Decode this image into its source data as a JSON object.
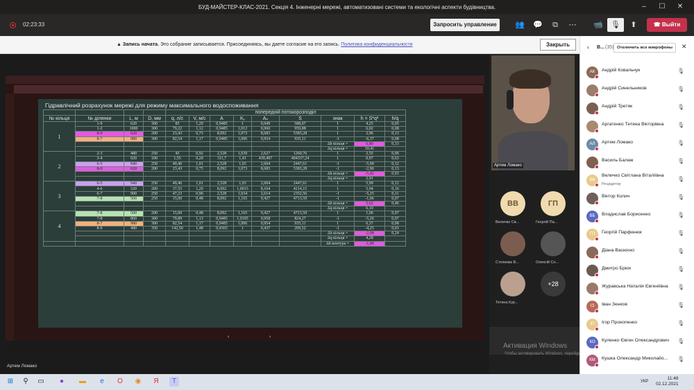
{
  "window": {
    "title": "БУД-МАЙСТЕР-КЛАС-2021. Секція 4. Інженерні мережі, автоматизовані системи та екологічні аспекти будівництва."
  },
  "toolbar": {
    "timer": "02:23:33",
    "request_control": "Запросить управление",
    "leave": "Выйти"
  },
  "notification": {
    "bold": "Запись начата.",
    "text": "Это собрание записывается. Присоединяясь, вы даете согласие на его запись.",
    "link": "Политика конфиденциальности",
    "close": "Закрыть"
  },
  "slide": {
    "title": "Гідравлічний розрахунок мережі для режиму максимального водоспоживання",
    "group_header": "попередній потокорозподіл",
    "headers": [
      "№ кільця",
      "№ ділянки",
      "L, м",
      "D, мм",
      "q, л/с",
      "V, м/с",
      "A",
      "K₁",
      "Aₙ",
      "S",
      "знак",
      "h = S*q²",
      "h/q"
    ],
    "delta_h": "Δh кільця =",
    "delta_q": "Δq кільця =",
    "delta_contour": "Δh контура =",
    "rings": [
      {
        "n": "1",
        "rows": [
          [
            "1-9",
            "620",
            "300",
            "85",
            "1,20",
            "0,9485",
            "1",
            "0,949",
            "588,07",
            "1",
            "4,25",
            "0,05",
            ""
          ],
          [
            "1-2",
            "1000",
            "300",
            "79,22",
            "1,12",
            "0,9485",
            "1,012",
            "0,960",
            "959,88",
            "1",
            "6,02",
            "0,08",
            ""
          ],
          [
            "8-9",
            "620",
            "200",
            "23,43",
            "0,75",
            "8,092",
            "1,073",
            "8,683",
            "5383,28",
            "1",
            "2,96",
            "0,13",
            "pk"
          ],
          [
            "8-7",
            "980",
            "300",
            "82,54",
            "1,17",
            "0,9485",
            "1,006",
            "0,954",
            "935,11",
            "-1",
            "-6,37",
            "0,08",
            "or"
          ]
        ],
        "dh": "6,80",
        "sum": "0,33",
        "dq": "10,41"
      },
      {
        "n": "2",
        "rows": [
          [
            "2-3",
            "480",
            "250",
            "45",
            "0,92",
            "2,528",
            "1,039",
            "2,627",
            "1260,76",
            "1",
            "2,55",
            "0,06",
            ""
          ],
          [
            "3-4",
            "920",
            "100",
            "1,55",
            "0,20",
            "311,7",
            "1,41",
            "439,497",
            "404337,24",
            "1",
            "0,97",
            "0,63",
            ""
          ],
          [
            "6-5",
            "940",
            "250",
            "49,46",
            "1,01",
            "2,528",
            "1,03",
            "2,604",
            "2447,61",
            "-1",
            "-5,99",
            "0,12",
            "lil"
          ],
          [
            "8-9",
            "620",
            "200",
            "23,43",
            "0,75",
            "8,092",
            "1,073",
            "8,683",
            "5383,28",
            "-1",
            "-2,96",
            "0,13",
            "pk"
          ]
        ],
        "dh": "-5,42",
        "sum": "0,93",
        "dq": "2,91"
      },
      {
        "n": "3",
        "rows": [
          [
            "6-5",
            "940",
            "250",
            "49,46",
            "1,01",
            "2,528",
            "1,03",
            "2,604",
            "2447,61",
            "1",
            "5,99",
            "0,12",
            "lil"
          ],
          [
            "4-6",
            "520",
            "200",
            "37,55",
            "1,20",
            "8,092",
            "1,0015",
            "8,104",
            "4214,15",
            "1",
            "5,94",
            "0,16",
            ""
          ],
          [
            "6-7",
            "900",
            "250",
            "47,23",
            "0,96",
            "2,528",
            "1,034",
            "2,614",
            "2352,56",
            "-1",
            "-5,25",
            "0,11",
            ""
          ],
          [
            "7-8",
            "500",
            "250",
            "15,00",
            "0,48",
            "8,092",
            "1,165",
            "9,427",
            "4713,59",
            "-1",
            "-1,06",
            "0,07",
            "gr"
          ]
        ],
        "dh": "5,62",
        "sum": "0,46",
        "dq": "6,10"
      },
      {
        "n": "4",
        "rows": [
          [
            "7-8",
            "500",
            "200",
            "15,00",
            "0,48",
            "8,092",
            "1,165",
            "9,427",
            "4713,59",
            "1",
            "1,06",
            "0,07",
            "gr"
          ],
          [
            "7-8",
            "860",
            "300",
            "79,89",
            "1,13",
            "0,9485",
            "1,0105",
            "0,958",
            "824,27",
            "-1",
            "-5,26",
            "0,07",
            ""
          ],
          [
            "8-7",
            "980",
            "300",
            "82,54",
            "1,17",
            "0,9485",
            "1,006",
            "0,954",
            "935,11",
            "1",
            "6,37",
            "0,08",
            "or"
          ],
          [
            "8-9",
            "480",
            "350",
            "142,50",
            "1,48",
            "0,4365",
            "1",
            "0,437",
            "209,52",
            "-1",
            "-4,25",
            "0,03",
            ""
          ]
        ],
        "dh": "-2,08",
        "sum": "0,24",
        "dq": "4,28"
      }
    ],
    "contour": "-1,80"
  },
  "video": {
    "name": "Артем Ломако"
  },
  "gallery": [
    {
      "initials": "ВВ",
      "name": "Величко Св..."
    },
    {
      "initials": "ГП",
      "name": "Георгій Па..."
    },
    {
      "initials": "",
      "name": "Стоякова В..."
    },
    {
      "initials": "",
      "name": "Олексій Со..."
    },
    {
      "initials": "",
      "name": "Тетяна Кур..."
    },
    {
      "initials": "+28",
      "name": ""
    }
  ],
  "activation": {
    "title": "Активация Windows",
    "text": "Чтобы активировать Windows, перейдите в раздел \"Параметры\"."
  },
  "panel": {
    "title": "В...",
    "count": "(35)",
    "mute_all": "Отключить все микрофоны",
    "participants": [
      {
        "initials": "АК",
        "name": "Андрій Ковальчук",
        "role": ""
      },
      {
        "initials": "",
        "name": "Андрій Синельников",
        "role": ""
      },
      {
        "initials": "",
        "name": "Андрій Третяк",
        "role": ""
      },
      {
        "initials": "",
        "name": "Аргатенко Тетяна Вікторівна",
        "role": ""
      },
      {
        "initials": "АЛ",
        "name": "Артем Ломако",
        "role": ""
      },
      {
        "initials": "",
        "name": "Василь Балаж",
        "role": ""
      },
      {
        "initials": "ВВ",
        "name": "Величко Світлана Віталіївна",
        "role": "Рецидитор"
      },
      {
        "initials": "",
        "name": "Віктор Колич",
        "role": ""
      },
      {
        "initials": "ВБ",
        "name": "Владислав Борисенко",
        "role": ""
      },
      {
        "initials": "ГП",
        "name": "Георгій Парфенюк",
        "role": ""
      },
      {
        "initials": "",
        "name": "Діана Васюхно",
        "role": ""
      },
      {
        "initials": "",
        "name": "Дмитро Брюх",
        "role": ""
      },
      {
        "initials": "",
        "name": "Журавська Наталія Євгеніївна",
        "role": ""
      },
      {
        "initials": "ІЗ",
        "name": "Іван Зенков",
        "role": ""
      },
      {
        "initials": "ІП",
        "name": "Ігор Прокопенко",
        "role": ""
      },
      {
        "initials": "КО",
        "name": "Куленко Євген Олександрович",
        "role": ""
      },
      {
        "initials": "КМ",
        "name": "Кушка Олександр Миколайо...",
        "role": ""
      }
    ]
  },
  "caption": {
    "name": "Артем Ломако"
  },
  "taskbar": {
    "time": "11:48",
    "date": "02.12.2021",
    "lang": "УКР"
  }
}
